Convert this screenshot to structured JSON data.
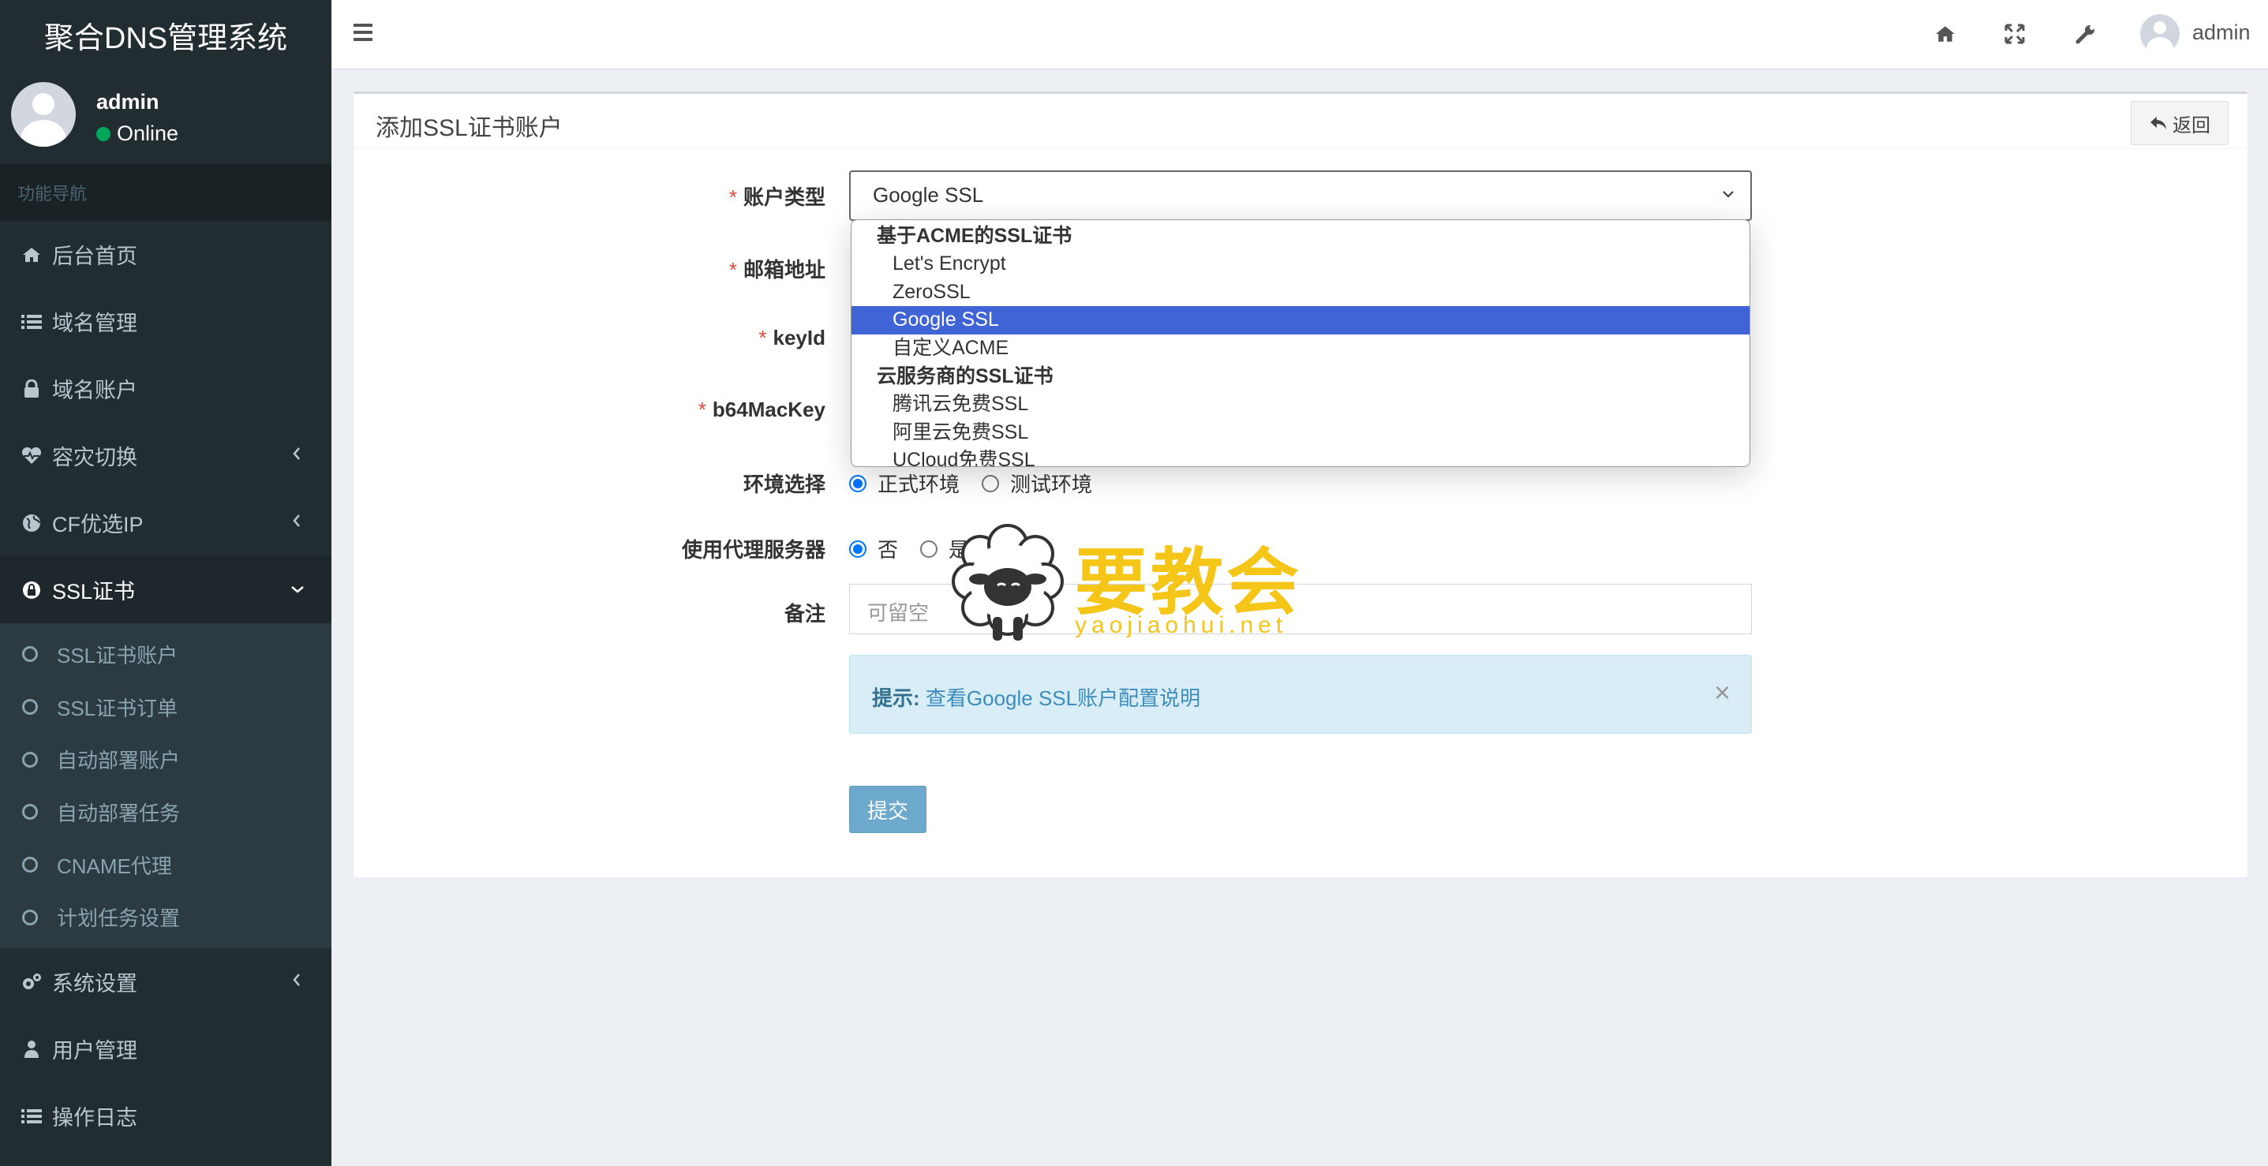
{
  "app": {
    "title": "聚合DNS管理系统"
  },
  "user": {
    "name": "admin",
    "status": "Online"
  },
  "sidebar": {
    "header": "功能导航",
    "items": [
      {
        "label": "后台首页",
        "icon": "home-icon"
      },
      {
        "label": "域名管理",
        "icon": "list-icon"
      },
      {
        "label": "域名账户",
        "icon": "lock-icon"
      },
      {
        "label": "容灾切换",
        "icon": "heartbeat-icon"
      },
      {
        "label": "CF优选IP",
        "icon": "globe-icon"
      },
      {
        "label": "SSL证书",
        "icon": "lock-circle-icon"
      },
      {
        "label": "系统设置",
        "icon": "cogs-icon"
      },
      {
        "label": "用户管理",
        "icon": "user-icon"
      },
      {
        "label": "操作日志",
        "icon": "list-icon"
      }
    ],
    "ssl_sub": [
      "SSL证书账户",
      "SSL证书订单",
      "自动部署账户",
      "自动部署任务",
      "CNAME代理",
      "计划任务设置"
    ]
  },
  "topbar": {
    "user": "admin"
  },
  "box": {
    "title": "添加SSL证书账户",
    "back": "返回"
  },
  "form": {
    "account_type_label": "账户类型",
    "email_label": "邮箱地址",
    "keyid_label": "keyId",
    "b64mackey_label": "b64MacKey",
    "env_label": "环境选择",
    "env_options": [
      "正式环境",
      "测试环境"
    ],
    "proxy_label": "使用代理服务器",
    "proxy_options": [
      "否",
      "是"
    ],
    "remark_label": "备注",
    "remark_placeholder": "可留空",
    "account_type_value": "Google SSL",
    "tip_label": "提示:",
    "tip_link": "查看Google SSL账户配置说明",
    "submit": "提交"
  },
  "dropdown": {
    "group1": "基于ACME的SSL证书",
    "group1_options": [
      "Let's Encrypt",
      "ZeroSSL",
      "Google SSL",
      "自定义ACME"
    ],
    "group2": "云服务商的SSL证书",
    "group2_options": [
      "腾讯云免费SSL",
      "阿里云免费SSL",
      "UCloud免费SSL"
    ],
    "selected": "Google SSL"
  },
  "watermark": {
    "text": "要教会",
    "url": "yaojiaohui.net"
  }
}
